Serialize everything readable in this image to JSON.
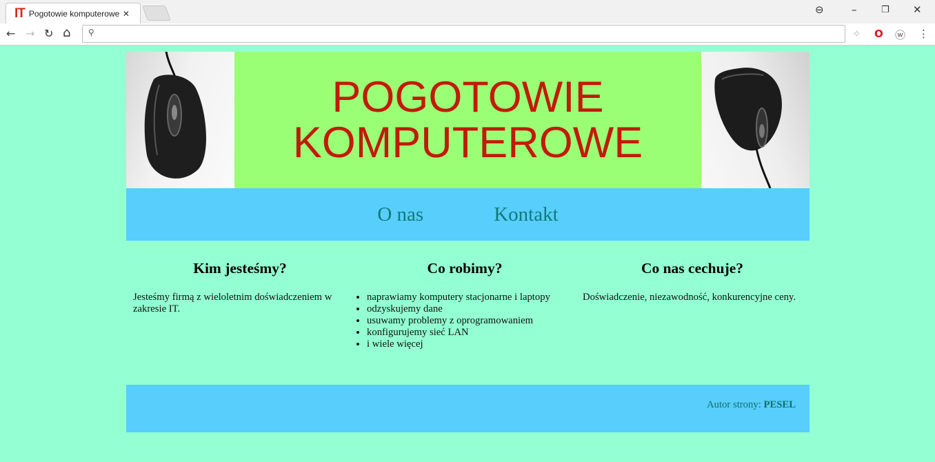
{
  "browser": {
    "tab_logo": "IT",
    "tab_title": "Pogotowie komputerowe",
    "tab_close": "✕",
    "address": "",
    "win_account": "⊖",
    "win_min": "–",
    "win_restore": "❐",
    "win_close": "✕",
    "back": "←",
    "forward": "→",
    "reload": "↻",
    "home": "⌂",
    "menu": "⋮"
  },
  "banner": {
    "line1": "POGOTOWIE",
    "line2": "KOMPUTEROWE"
  },
  "menu": {
    "items": [
      {
        "label": "O nas"
      },
      {
        "label": "Kontakt"
      }
    ]
  },
  "sections": {
    "about": {
      "heading": "Kim jesteśmy?",
      "text": "Jesteśmy firmą z wieloletnim doświadczeniem w zakresie IT."
    },
    "services": {
      "heading": "Co robimy?",
      "items": [
        "naprawiamy komputery stacjonarne i laptopy",
        "odzyskujemy dane",
        "usuwamy problemy z oprogramowaniem",
        "konfigurujemy sieć LAN",
        "i wiele więcej"
      ]
    },
    "features": {
      "heading": "Co nas cechuje?",
      "text": "Doświadczenie, niezawodność, konkurencyjne ceny."
    }
  },
  "footer": {
    "label": "Autor strony: ",
    "author": "PESEL"
  },
  "colors": {
    "page_bg": "#93ffd2",
    "banner_bg": "#9aff75",
    "banner_text": "#c11b0b",
    "menu_bg": "#57cefc",
    "link": "#117a7a"
  }
}
